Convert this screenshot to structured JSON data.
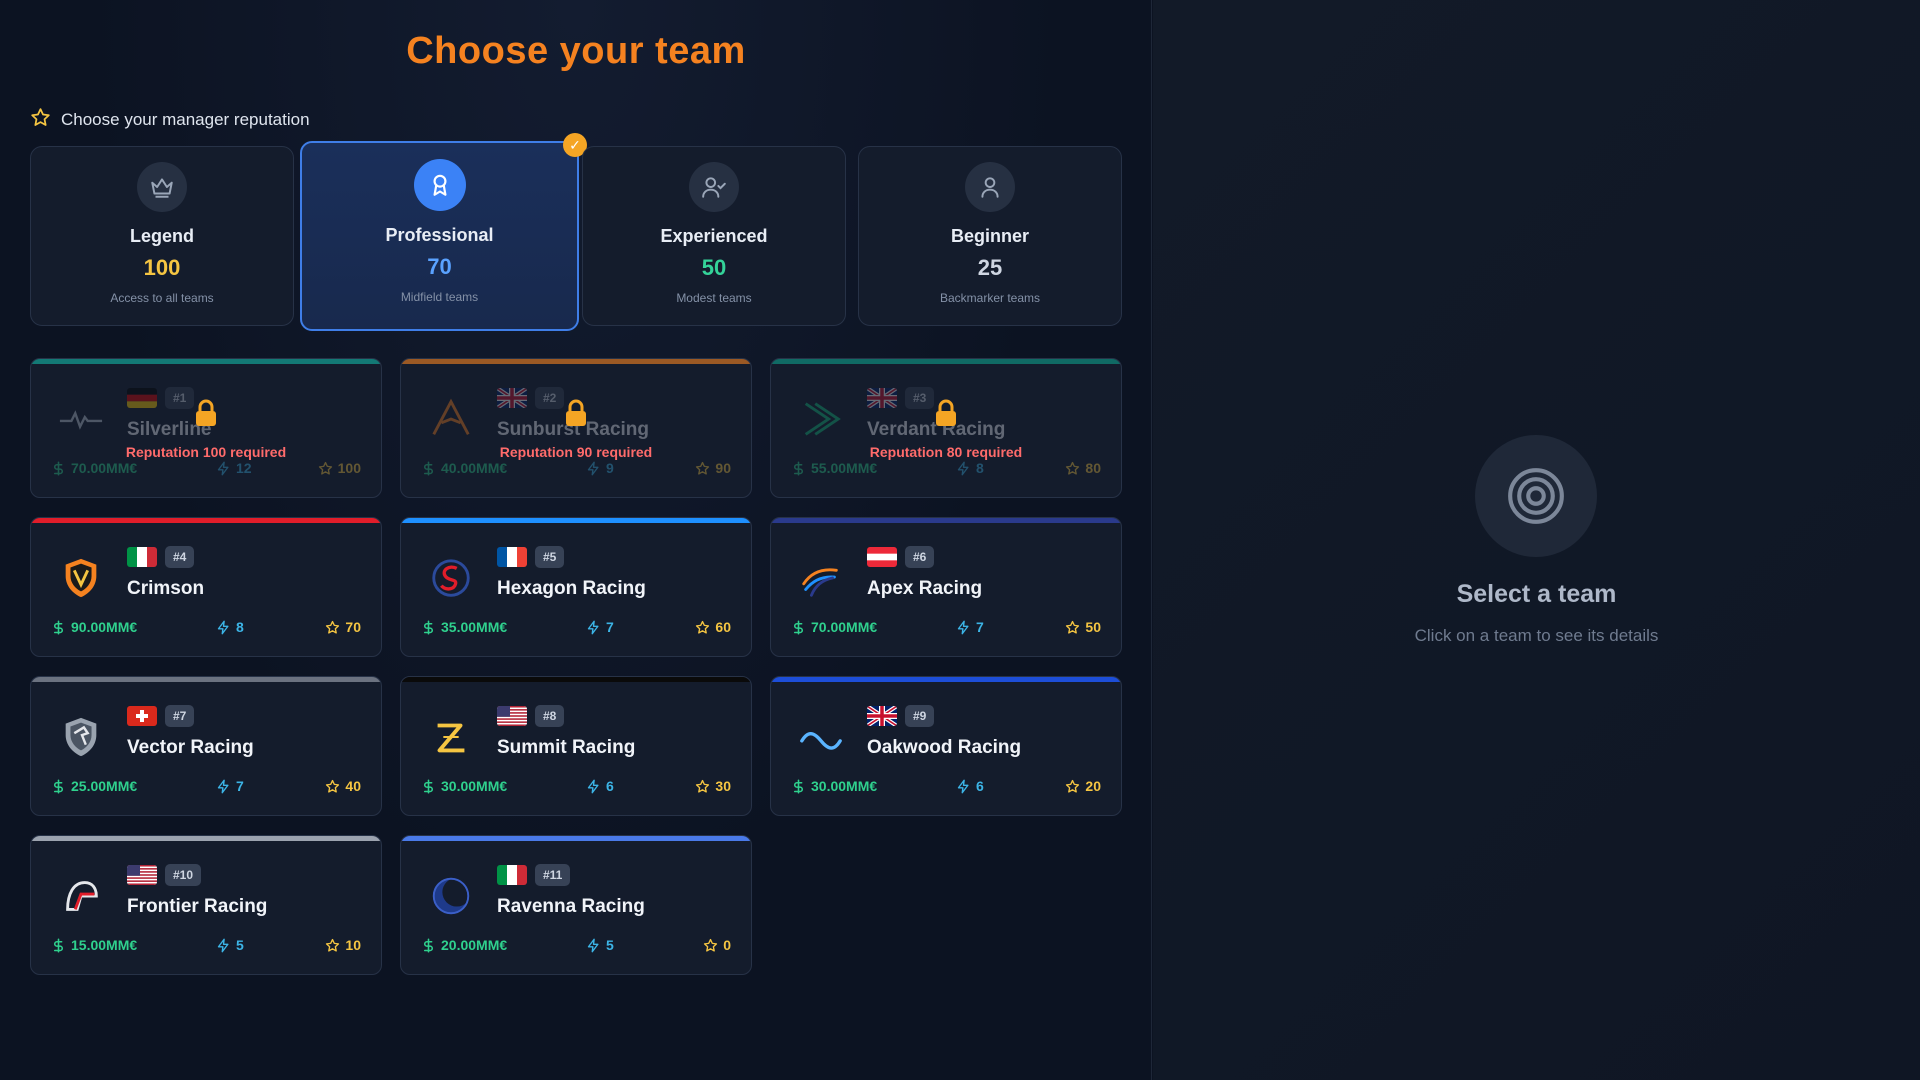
{
  "title": "Choose your team",
  "reputation_header": "Choose your manager reputation",
  "reputations": [
    {
      "name": "Legend",
      "value": "100",
      "desc": "Access to all teams",
      "color": "#f5c542",
      "icon": "crown-icon"
    },
    {
      "name": "Professional",
      "value": "70",
      "desc": "Midfield teams",
      "color": "#5aa2ff",
      "icon": "award-icon",
      "selected": true,
      "check": "✓"
    },
    {
      "name": "Experienced",
      "value": "50",
      "desc": "Modest teams",
      "color": "#34d399",
      "icon": "user-check-icon"
    },
    {
      "name": "Beginner",
      "value": "25",
      "desc": "Backmarker teams",
      "color": "#cfd6e2",
      "icon": "user-icon"
    }
  ],
  "teams": [
    {
      "rank": "#1",
      "name": "Silverline",
      "flag": "germany",
      "budget": "70.00MM€",
      "power": "12",
      "reputation": "100",
      "accent": "#12b8a6",
      "locked": true,
      "lock_text": "Reputation 100 required",
      "logo": "pulse-logo-icon"
    },
    {
      "rank": "#2",
      "name": "Sunburst Racing",
      "flag": "uk",
      "budget": "40.00MM€",
      "power": "9",
      "reputation": "90",
      "accent": "#f58220",
      "locked": true,
      "lock_text": "Reputation 90 required",
      "logo": "chevron-a-logo-icon"
    },
    {
      "rank": "#3",
      "name": "Verdant Racing",
      "flag": "uk",
      "budget": "55.00MM€",
      "power": "8",
      "reputation": "80",
      "accent": "#0e9f8a",
      "locked": true,
      "lock_text": "Reputation 80 required",
      "logo": "arrow-logo-icon"
    },
    {
      "rank": "#4",
      "name": "Crimson",
      "flag": "italy",
      "budget": "90.00MM€",
      "power": "8",
      "reputation": "70",
      "accent": "#e11d2a",
      "logo": "shield-v-logo-icon"
    },
    {
      "rank": "#5",
      "name": "Hexagon Racing",
      "flag": "france",
      "budget": "35.00MM€",
      "power": "7",
      "reputation": "60",
      "accent": "#1e90ff",
      "logo": "hexagon-logo-icon"
    },
    {
      "rank": "#6",
      "name": "Apex Racing",
      "flag": "austria",
      "budget": "70.00MM€",
      "power": "7",
      "reputation": "50",
      "accent": "#2a3a8c",
      "logo": "swoosh-logo-icon"
    },
    {
      "rank": "#7",
      "name": "Vector Racing",
      "flag": "switzerland",
      "budget": "25.00MM€",
      "power": "7",
      "reputation": "40",
      "accent": "#6b7280",
      "logo": "horse-shield-logo-icon"
    },
    {
      "rank": "#8",
      "name": "Summit Racing",
      "flag": "usa",
      "budget": "30.00MM€",
      "power": "6",
      "reputation": "30",
      "accent": "#0a0a0a",
      "logo": "z-logo-icon"
    },
    {
      "rank": "#9",
      "name": "Oakwood Racing",
      "flag": "uk",
      "budget": "30.00MM€",
      "power": "6",
      "reputation": "20",
      "accent": "#1d4ed8",
      "logo": "wave-logo-icon"
    },
    {
      "rank": "#10",
      "name": "Frontier Racing",
      "flag": "usa",
      "budget": "15.00MM€",
      "power": "5",
      "reputation": "10",
      "accent": "#9ca3af",
      "logo": "helmet-logo-icon"
    },
    {
      "rank": "#11",
      "name": "Ravenna Racing",
      "flag": "italy",
      "budget": "20.00MM€",
      "power": "5",
      "reputation": "0",
      "accent": "#4a7ae8",
      "logo": "moon-logo-icon"
    }
  ],
  "details": {
    "title": "Select a team",
    "subtitle": "Click on a team to see its details",
    "icon": "target-icon"
  }
}
